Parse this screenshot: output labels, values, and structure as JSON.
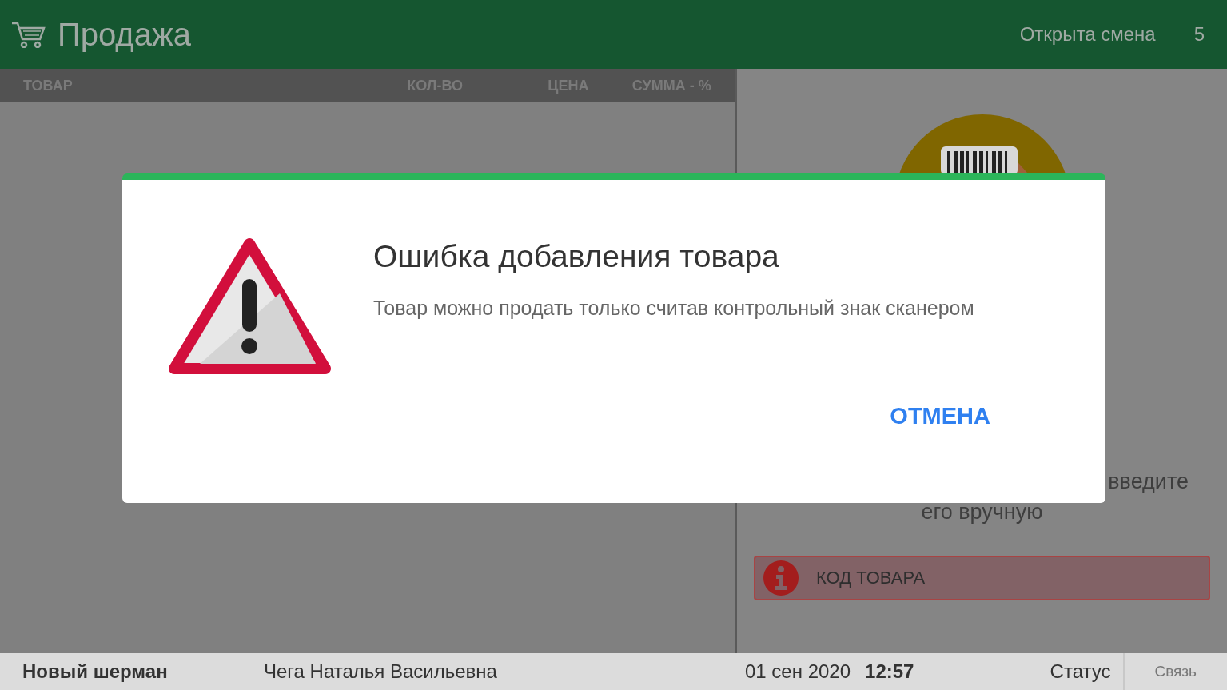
{
  "header": {
    "title": "Продажа",
    "shift_status": "Открыта смена",
    "shift_number": "5"
  },
  "table": {
    "columns": [
      "ТОВАР",
      "КОЛ-ВО",
      "ЦЕНА",
      "СУММА - %"
    ]
  },
  "scan_panel": {
    "hint_lines": [
      "введите",
      "его вручную"
    ],
    "code_field": {
      "placeholder": "КОД ТОВАРА",
      "error": true
    }
  },
  "status_bar": {
    "store": "Новый шерман",
    "cashier": "Чега Наталья Васильевна",
    "date": "01 сен 2020",
    "time": "12:57",
    "status": "Статус",
    "connection": "Связь"
  },
  "dialog": {
    "title": "Ошибка добавления товара",
    "message": "Товар можно продать только считав контрольный знак сканером",
    "buttons": [
      "ОТМЕНА"
    ]
  }
}
